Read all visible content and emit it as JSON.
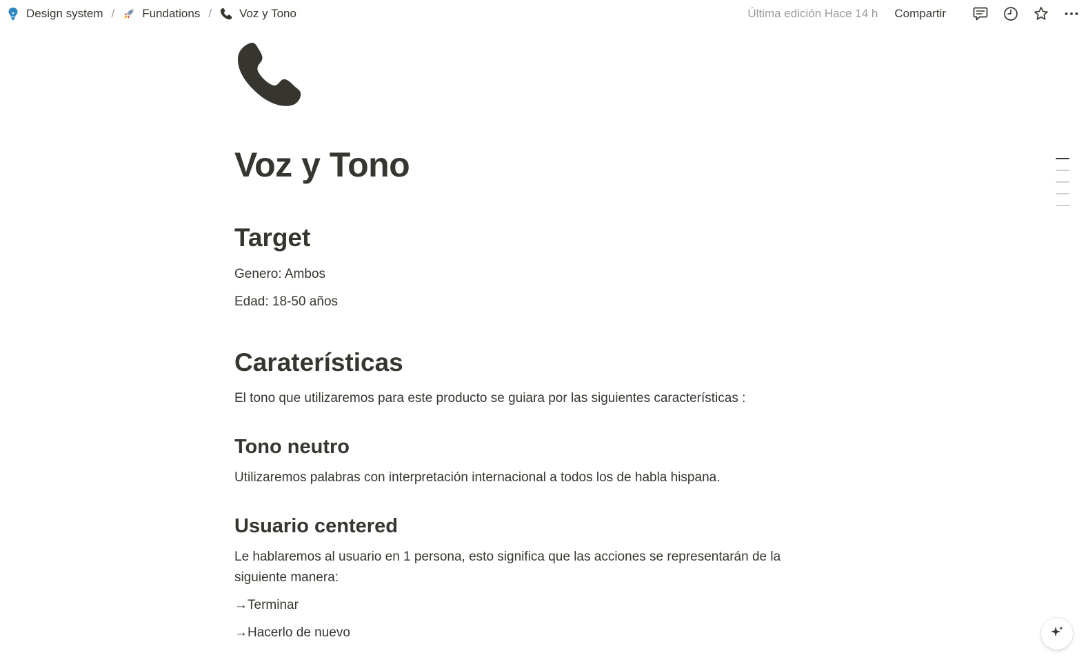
{
  "breadcrumb": {
    "items": [
      {
        "label": "Design system",
        "icon": "lightbulb-icon"
      },
      {
        "label": "Fundations",
        "icon": "rocket-icon"
      },
      {
        "label": "Voz y Tono",
        "icon": "phone-icon"
      }
    ],
    "separator": "/"
  },
  "topbar": {
    "edited": "Última edición Hace 14 h",
    "share_label": "Compartir",
    "icons": [
      "comment-icon",
      "history-icon",
      "star-icon",
      "more-icon"
    ]
  },
  "page": {
    "icon": "phone-icon",
    "title": "Voz y Tono",
    "sections": {
      "target": {
        "heading": "Target",
        "lines": [
          "Genero: Ambos",
          "Edad: 18-50 años"
        ]
      },
      "caracteristicas": {
        "heading": "Caraterísticas",
        "intro": "El tono que utilizaremos para este producto se guiara por las siguientes características :"
      },
      "tono_neutro": {
        "heading": "Tono neutro",
        "text": "Utilizaremos palabras con interpretación internacional a todos los de habla hispana."
      },
      "usuario_centered": {
        "heading": "Usuario centered",
        "text": "Le hablaremos al usuario en 1 persona, esto significa que las acciones se representarán de la siguiente manera:",
        "bullets": [
          "→Terminar",
          "→Hacerlo de nuevo"
        ]
      }
    }
  },
  "toc": {
    "count": 5,
    "active_index": 0
  },
  "colors": {
    "text": "#37352f",
    "muted": "#9b9a97",
    "background": "#ffffff"
  }
}
